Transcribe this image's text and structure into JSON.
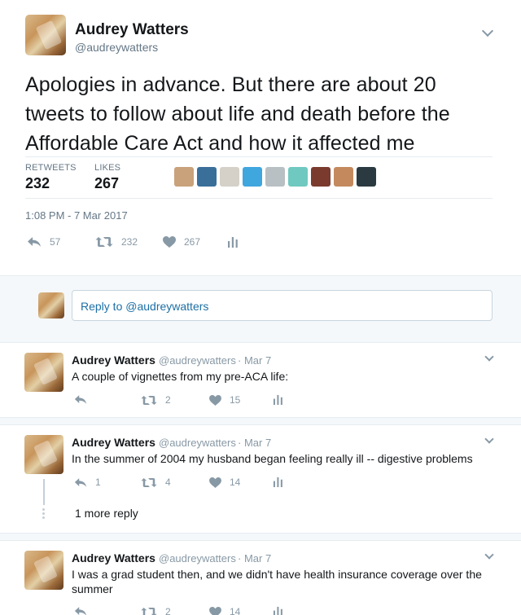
{
  "main_tweet": {
    "name": "Audrey Watters",
    "handle": "@audreywatters",
    "text": "Apologies in advance. But there are about 20 tweets to follow about life and death before the Affordable Care Act and how it affected me",
    "retweets_label": "RETWEETS",
    "retweets_value": "232",
    "likes_label": "LIKES",
    "likes_value": "267",
    "timestamp": "1:08 PM - 7 Mar 2017",
    "actions": {
      "reply_count": "57",
      "retweet_count": "232",
      "like_count": "267"
    },
    "likers": [
      "#c9a17a",
      "#3a6f9a",
      "#d5d1c8",
      "#3fa6de",
      "#b8c0c4",
      "#6fc9c0",
      "#7a3b2e",
      "#c48a5e",
      "#2b3a40"
    ]
  },
  "reply_bar": {
    "placeholder": "Reply to @audreywatters"
  },
  "replies": [
    {
      "name": "Audrey Watters",
      "handle": "@audreywatters",
      "date": "· Mar 7",
      "text": "A couple of vignettes from my pre-ACA life:",
      "reply_count": "",
      "retweet_count": "2",
      "like_count": "15"
    },
    {
      "name": "Audrey Watters",
      "handle": "@audreywatters",
      "date": "· Mar 7",
      "text": "In the summer of 2004 my husband began feeling really ill -- digestive problems",
      "reply_count": "1",
      "retweet_count": "4",
      "like_count": "14",
      "more_reply": "1 more reply"
    },
    {
      "name": "Audrey Watters",
      "handle": "@audreywatters",
      "date": "· Mar 7",
      "text": "I was a grad student then, and we didn't have health insurance coverage over the summer",
      "reply_count": "",
      "retweet_count": "2",
      "like_count": "14"
    }
  ],
  "icons": {
    "reply": "reply-icon",
    "retweet": "retweet-icon",
    "like": "heart-icon",
    "analytics": "analytics-icon",
    "menu": "chevron-down-icon"
  },
  "colors": {
    "text": "#14171a",
    "muted": "#657786",
    "icon": "#8899a6",
    "link": "#1d6fa5",
    "bg_gray": "#f5f8fa"
  }
}
